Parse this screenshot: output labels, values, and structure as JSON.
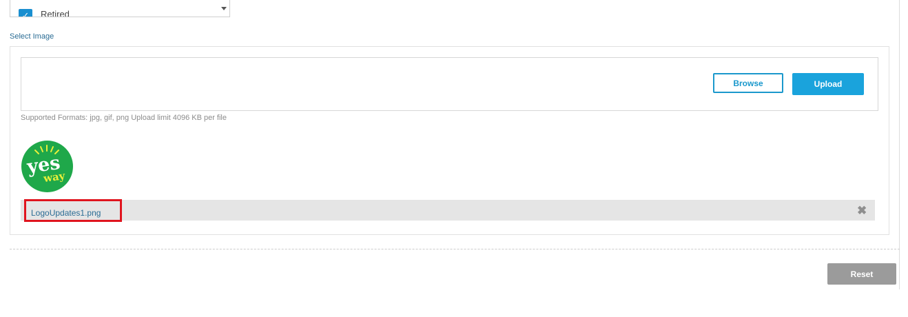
{
  "status_select": {
    "option_label": "Retired",
    "checked": true,
    "icons": {
      "check": "check-icon",
      "dropdown": "chevron-down-icon"
    }
  },
  "image_section": {
    "label": "Select Image",
    "browse_label": "Browse",
    "upload_label": "Upload",
    "formats_text": "Supported Formats: jpg, gif, png Upload limit 4096 KB per file",
    "logo": {
      "word_top": "yes",
      "word_bottom": "way",
      "bg_color": "#1fa84a",
      "accent_color": "#e8ef3a"
    },
    "uploaded_file": {
      "name": "LogoUpdates1.png",
      "remove_icon": "close-icon"
    }
  },
  "actions": {
    "reset_label": "Reset"
  },
  "colors": {
    "primary": "#1aa3dc",
    "link": "#2a6c94",
    "highlight": "#e0141e",
    "disabled": "#9b9b9b"
  }
}
